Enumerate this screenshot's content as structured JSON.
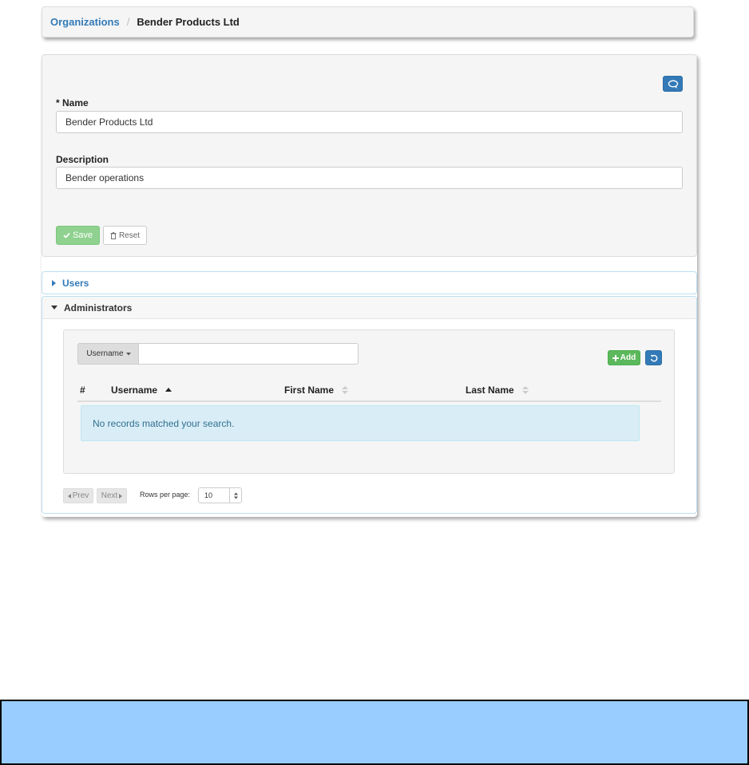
{
  "breadcrumb": {
    "link_label": "Organizations",
    "separator": "/",
    "current_label": "Bender Products Ltd"
  },
  "form": {
    "name_label": "* Name",
    "name_value": "Bender Products Ltd",
    "description_label": "Description",
    "description_value": "Bender operations",
    "save_label": "Save",
    "reset_label": "Reset",
    "chat_icon": "chat-bubble-icon"
  },
  "accordion": {
    "users_label": "Users",
    "admins_label": "Administrators"
  },
  "admins": {
    "search": {
      "field_label": "Username",
      "value": ""
    },
    "add_label": "Add",
    "columns": [
      {
        "label": "#"
      },
      {
        "label": "Username"
      },
      {
        "label": "First Name"
      },
      {
        "label": "Last Name"
      }
    ],
    "empty_message": "No records matched your search."
  },
  "pagination": {
    "prev_label": "Prev",
    "next_label": "Next",
    "rows_label": "Rows per page:",
    "rows_value": "10"
  },
  "colors": {
    "primary": "#337ab7",
    "success": "#5cb85c",
    "save_disabled": "#8fd18f",
    "info_bg": "#d9edf7",
    "bottom_bar": "#99ccff"
  }
}
